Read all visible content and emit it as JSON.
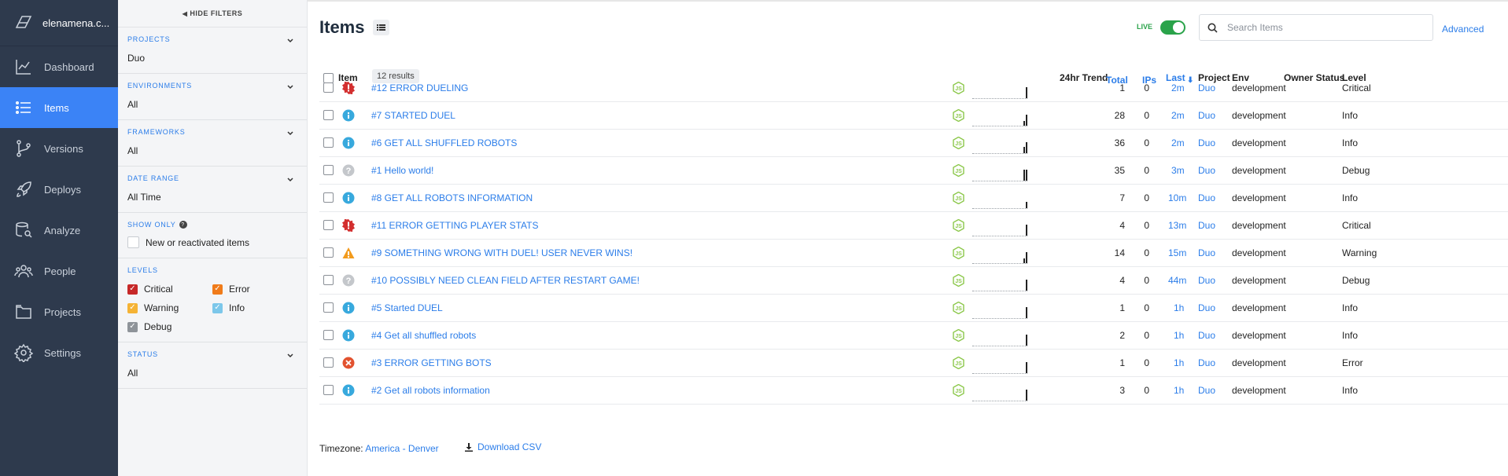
{
  "nav": {
    "brand": "elenamena.c...",
    "items": [
      {
        "label": "Dashboard",
        "icon": "chart-line-icon"
      },
      {
        "label": "Items",
        "icon": "list-icon",
        "active": true
      },
      {
        "label": "Versions",
        "icon": "branch-icon"
      },
      {
        "label": "Deploys",
        "icon": "rocket-icon"
      },
      {
        "label": "Analyze",
        "icon": "analyze-icon"
      },
      {
        "label": "People",
        "icon": "people-icon"
      },
      {
        "label": "Projects",
        "icon": "folder-icon"
      },
      {
        "label": "Settings",
        "icon": "gear-icon"
      }
    ]
  },
  "filters": {
    "hide_label": "HIDE FILTERS",
    "projects": {
      "label": "PROJECTS",
      "value": "Duo"
    },
    "environments": {
      "label": "ENVIRONMENTS",
      "value": "All"
    },
    "frameworks": {
      "label": "FRAMEWORKS",
      "value": "All"
    },
    "date_range": {
      "label": "DATE RANGE",
      "value": "All Time"
    },
    "show_only": {
      "label": "SHOW ONLY",
      "option": "New or reactivated items"
    },
    "levels": {
      "label": "LEVELS",
      "options": [
        {
          "label": "Critical",
          "color": "#c62828",
          "checked": true
        },
        {
          "label": "Error",
          "color": "#f07b1a",
          "checked": true
        },
        {
          "label": "Warning",
          "color": "#f5b335",
          "checked": true
        },
        {
          "label": "Info",
          "color": "#7cc7ea",
          "checked": true
        },
        {
          "label": "Debug",
          "color": "#8e9399",
          "checked": true
        }
      ]
    },
    "status": {
      "label": "STATUS",
      "value": "All"
    }
  },
  "header": {
    "title": "Items",
    "live_label": "LIVE",
    "search_placeholder": "Search Items",
    "advanced": "Advanced"
  },
  "table": {
    "columns": {
      "item": "Item",
      "results": "12 results",
      "trend": "24hr Trend",
      "total": "Total",
      "ips": "IPs",
      "last": "Last",
      "project": "Project",
      "env": "Env",
      "owner_status": "Owner Status",
      "level": "Level"
    },
    "rows": [
      {
        "name": "#12 ERROR DUELING",
        "icon": "critical",
        "total": "1",
        "ips": "0",
        "last": "2m",
        "project": "Duo",
        "env": "development",
        "level": "Critical"
      },
      {
        "name": "#7 STARTED DUEL",
        "icon": "info",
        "total": "28",
        "ips": "0",
        "last": "2m",
        "project": "Duo",
        "env": "development",
        "level": "Info"
      },
      {
        "name": "#6 GET ALL SHUFFLED ROBOTS",
        "icon": "info",
        "total": "36",
        "ips": "0",
        "last": "2m",
        "project": "Duo",
        "env": "development",
        "level": "Info"
      },
      {
        "name": "#1 Hello world!",
        "icon": "debug",
        "total": "35",
        "ips": "0",
        "last": "3m",
        "project": "Duo",
        "env": "development",
        "level": "Debug"
      },
      {
        "name": "#8 GET ALL ROBOTS INFORMATION",
        "icon": "info",
        "total": "7",
        "ips": "0",
        "last": "10m",
        "project": "Duo",
        "env": "development",
        "level": "Info"
      },
      {
        "name": "#11 ERROR GETTING PLAYER STATS",
        "icon": "critical",
        "total": "4",
        "ips": "0",
        "last": "13m",
        "project": "Duo",
        "env": "development",
        "level": "Critical"
      },
      {
        "name": "#9 SOMETHING WRONG WITH DUEL! USER NEVER WINS!",
        "icon": "warning",
        "total": "14",
        "ips": "0",
        "last": "15m",
        "project": "Duo",
        "env": "development",
        "level": "Warning"
      },
      {
        "name": "#10 POSSIBLY NEED CLEAN FIELD AFTER RESTART GAME!",
        "icon": "debug",
        "total": "4",
        "ips": "0",
        "last": "44m",
        "project": "Duo",
        "env": "development",
        "level": "Debug"
      },
      {
        "name": "#5 Started DUEL",
        "icon": "info",
        "total": "1",
        "ips": "0",
        "last": "1h",
        "project": "Duo",
        "env": "development",
        "level": "Info"
      },
      {
        "name": "#4 Get all shuffled robots",
        "icon": "info",
        "total": "2",
        "ips": "0",
        "last": "1h",
        "project": "Duo",
        "env": "development",
        "level": "Info"
      },
      {
        "name": "#3 ERROR GETTING BOTS",
        "icon": "error",
        "total": "1",
        "ips": "0",
        "last": "1h",
        "project": "Duo",
        "env": "development",
        "level": "Error"
      },
      {
        "name": "#2 Get all robots information",
        "icon": "info",
        "total": "3",
        "ips": "0",
        "last": "1h",
        "project": "Duo",
        "env": "development",
        "level": "Info"
      }
    ]
  },
  "footer": {
    "timezone_label": "Timezone:",
    "timezone": "America - Denver",
    "download": "Download CSV"
  },
  "colors": {
    "accent": "#3b83f6",
    "link": "#2b7de9",
    "live": "#2aa34a",
    "nav_bg": "#2e3a4d"
  }
}
